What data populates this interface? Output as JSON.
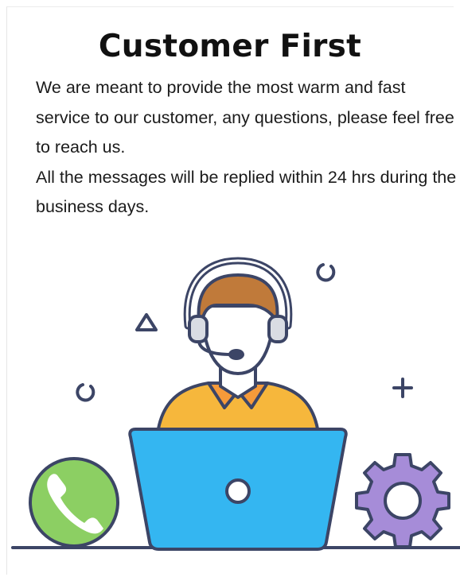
{
  "header": {
    "title": "Customer First"
  },
  "description": {
    "paragraph_1": "We are meant to provide the most warm and fast service to our customer, any questions, please feel free to reach us.",
    "paragraph_2": "All the messages will be replied within 24 hrs during the business days."
  },
  "illustration": {
    "icons": [
      "headset-agent-icon",
      "laptop-icon",
      "phone-icon",
      "gear-icon",
      "triangle-icon",
      "plus-icon",
      "circle-arc-icon"
    ],
    "colors": {
      "outline": "#3c4566",
      "hair": "#c07a3a",
      "skin": "#ffffff",
      "shirt": "#f6b73c",
      "collar": "#f59a3a",
      "laptop": "#34b6f1",
      "phone_circle": "#8ccf63",
      "gear": "#a68cd8"
    }
  }
}
